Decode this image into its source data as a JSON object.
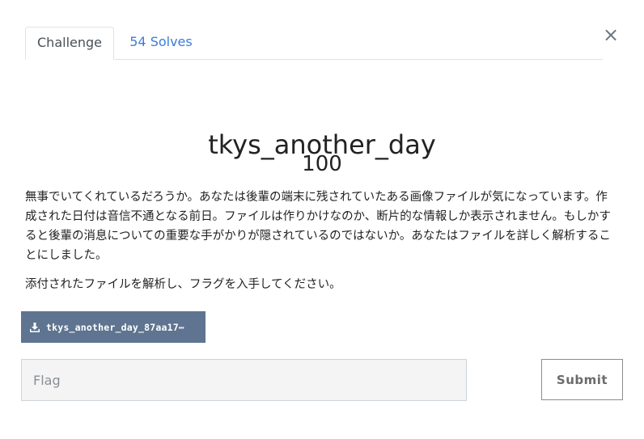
{
  "close": {
    "symbol": "×"
  },
  "tabs": [
    {
      "label": "Challenge",
      "active": true
    },
    {
      "label": "54 Solves",
      "active": false
    }
  ],
  "challenge": {
    "name": "tkys_another_day",
    "value": "100",
    "description": [
      "無事でいてくれているだろうか。あなたは後輩の端末に残されていたある画像ファイルが気になっています。作成された日付は音信不通となる前日。ファイルは作りかけなのか、断片的な情報しか表示されません。もしかすると後輩の消息についての重要な手がかりが隠されているのではないか。あなたはファイルを詳しく解析することにしました。",
      "添付されたファイルを解析し、フラグを入手してください。"
    ],
    "file": {
      "label": "tkys_another_day_87aa17⋯",
      "icon": "download-icon"
    }
  },
  "form": {
    "flag_placeholder": "Flag",
    "submit_label": "Submit"
  },
  "colors": {
    "tab_link": "#3b7dd8",
    "download_button": "#5e7490",
    "input_background": "#f4f4f4"
  }
}
